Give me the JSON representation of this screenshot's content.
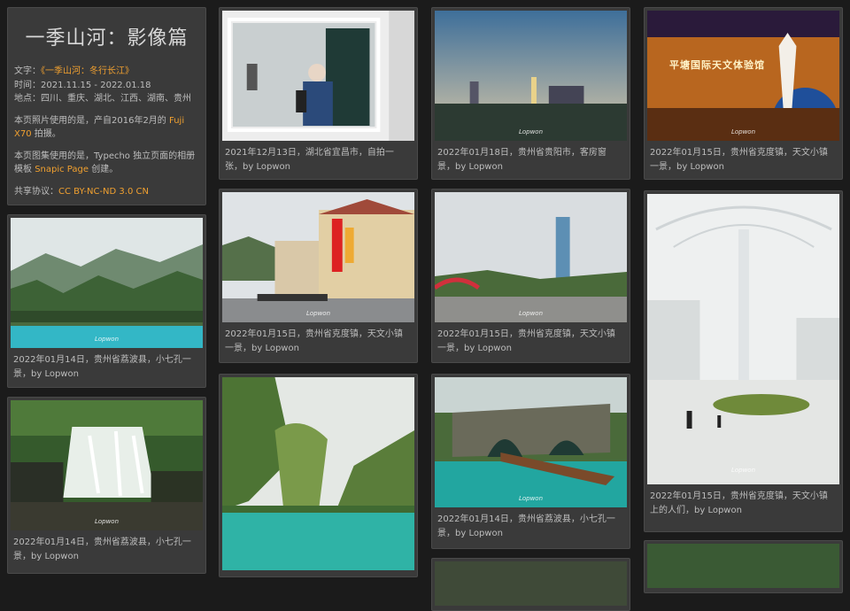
{
  "intro": {
    "title": "一季山河：影像篇",
    "text_label": "文字：",
    "text_link": "《一季山河：冬行长江》",
    "time": "时间：2021.11.15 - 2022.01.18",
    "places": "地点：四川、重庆、湖北、江西、湖南、贵州",
    "camera_pre": "本页照片使用的是，产自2016年2月的 ",
    "camera_link": "Fuji X70",
    "camera_post": " 拍摄。",
    "gallery_pre": "本页图集使用的是，Typecho 独立页面的相册模板 ",
    "gallery_link": "Snapic Page",
    "gallery_post": " 创建。",
    "license_label": "共享协议：",
    "license_link": "CC BY-NC-ND 3.0 CN"
  },
  "watermark": "Lopwon",
  "cards": [
    {
      "caption": "2022年01月14日，贵州省荔波县，小七孔一景，by Lopwon"
    },
    {
      "caption": "2022年01月14日，贵州省荔波县，小七孔一景，by Lopwon"
    },
    {
      "caption": "2021年12月13日，湖北省宜昌市，自拍一张，by Lopwon"
    },
    {
      "caption": "2022年01月15日，贵州省克度镇，天文小镇一景，by Lopwon"
    },
    {
      "caption": "2022年01月18日，贵州省贵阳市，客房窗景，by Lopwon"
    },
    {
      "caption": "2022年01月15日，贵州省克度镇，天文小镇一景，by Lopwon"
    },
    {
      "caption": "2022年01月14日，贵州省荔波县，小七孔一景，by Lopwon"
    },
    {
      "caption": "2022年01月15日，贵州省克度镇，天文小镇一景，by Lopwon"
    },
    {
      "caption": "2022年01月15日，贵州省克度镇，天文小镇上的人们，by Lopwon"
    }
  ],
  "museum_sign": "平塘国际天文体验馆",
  "colors": {
    "accent": "#f0a030",
    "background": "#1b1b1b",
    "card": "#3a3a3a"
  }
}
